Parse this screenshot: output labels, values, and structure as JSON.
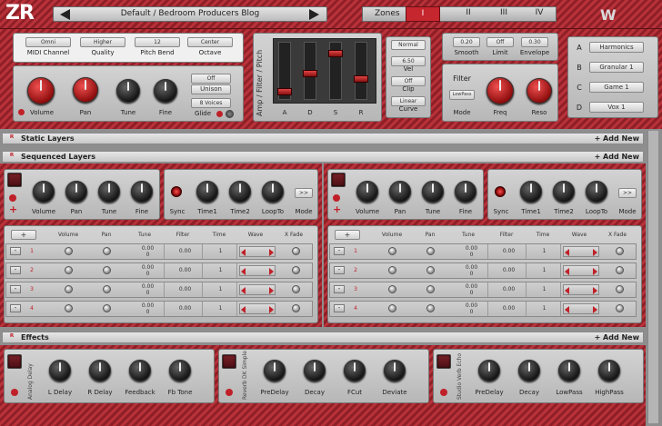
{
  "app": {
    "logo": "ZR",
    "preset": "Default / Bedroom Producers Blog",
    "zones_label": "Zones",
    "zones": [
      "I",
      "II",
      "III",
      "IV"
    ],
    "brand": "W"
  },
  "top": {
    "midi": [
      {
        "value": "Omni",
        "label": "MIDI Channel"
      },
      {
        "value": "Higher",
        "label": "Quality"
      },
      {
        "value": "12",
        "label": "Pitch Bend"
      },
      {
        "value": "Center",
        "label": "Octave"
      }
    ],
    "knobs": [
      "Volume",
      "Pan",
      "Tune",
      "Fine"
    ],
    "unison_value": "Off",
    "unison_label": "Unison",
    "voices_label": "8 Voices",
    "glide_label": "Glide",
    "amp_title": "Amp / Filter / Pitch",
    "adsr": [
      "A",
      "D",
      "S",
      "R"
    ],
    "amp_side": [
      {
        "value": "Normal"
      },
      {
        "value": "6.50",
        "label": "Vel"
      },
      {
        "value": "Off",
        "label": "Clip"
      },
      {
        "value": "Linear",
        "label": "Curve"
      }
    ],
    "smooth": {
      "value": "0.20",
      "label": "Smooth"
    },
    "limit": {
      "value": "Off",
      "label": "Limit"
    },
    "envelope": {
      "value": "0.30",
      "label": "Envelope"
    },
    "filter_label": "Filter",
    "filter_mode": "LowPass",
    "mode_label": "Mode",
    "freq_label": "Freq",
    "reso_label": "Reso",
    "slots": [
      {
        "key": "A",
        "name": "Harmonics"
      },
      {
        "key": "B",
        "name": "Granular 1"
      },
      {
        "key": "C",
        "name": "Game 1"
      },
      {
        "key": "D",
        "name": "Vox 1"
      }
    ]
  },
  "sections": {
    "static": "Static Layers",
    "sequenced": "Sequenced Layers",
    "effects": "Effects",
    "add": "+ Add New"
  },
  "seq": {
    "knobs": [
      "Volume",
      "Pan",
      "Tune",
      "Fine"
    ],
    "knobs2": [
      "Sync",
      "Time1",
      "Time2",
      "LoopTo",
      "Mode"
    ],
    "mode_btn": ">>",
    "headers": [
      "Volume",
      "Pan",
      "Tune",
      "Filter",
      "Time",
      "Wave",
      "X Fade"
    ],
    "rows": [
      {
        "n": "1",
        "tune_a": "0.00",
        "tune_b": "0",
        "filter": "0.00",
        "time": "1"
      },
      {
        "n": "2",
        "tune_a": "0.00",
        "tune_b": "0",
        "filter": "0.00",
        "time": "1"
      },
      {
        "n": "3",
        "tune_a": "0.00",
        "tune_b": "0",
        "filter": "0.00",
        "time": "1"
      },
      {
        "n": "4",
        "tune_a": "0.00",
        "tune_b": "0",
        "filter": "0.00",
        "time": "1"
      }
    ],
    "add_btn": "+",
    "del_btn": "-"
  },
  "effects": [
    {
      "name": "Analog Delay",
      "knobs": [
        "L Delay",
        "R Delay",
        "Feedback",
        "Fb Tone"
      ]
    },
    {
      "name": "Reverb DK Simple",
      "knobs": [
        "PreDelay",
        "Decay",
        "FCut",
        "Deviate"
      ]
    },
    {
      "name": "Studio Verb Echo",
      "knobs": [
        "PreDelay",
        "Decay",
        "LowPass",
        "HighPass"
      ]
    }
  ]
}
